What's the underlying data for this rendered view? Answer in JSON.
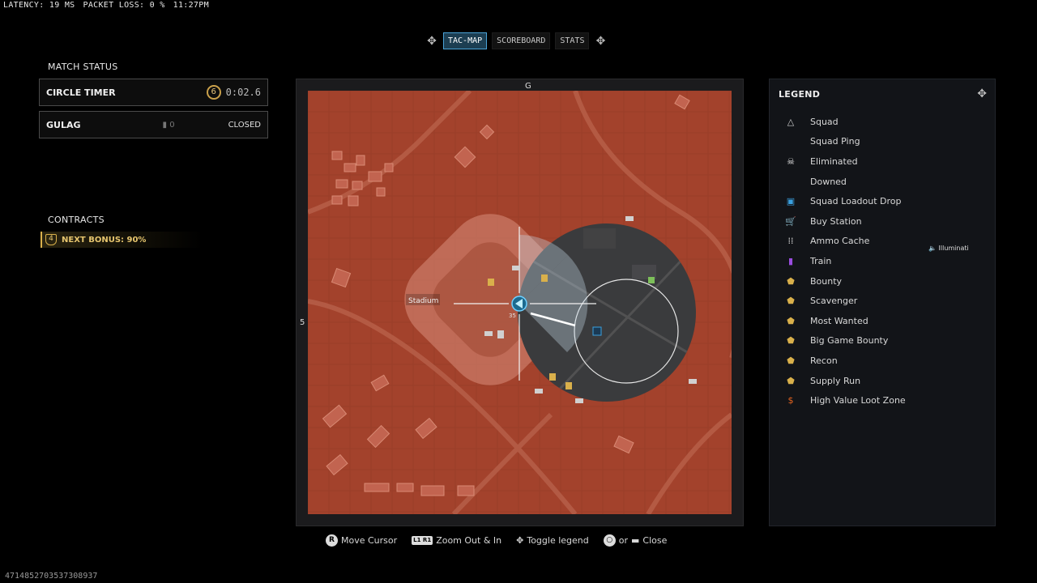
{
  "topbar": {
    "latency": "LATENCY: 19 MS",
    "packet_loss": "PACKET LOSS: 0 %",
    "clock": "11:27PM"
  },
  "tabs": [
    {
      "label": "TAC-MAP",
      "active": true
    },
    {
      "label": "SCOREBOARD",
      "active": false
    },
    {
      "label": "STATS",
      "active": false
    }
  ],
  "match_status": {
    "title": "MATCH STATUS",
    "circle_timer": {
      "label": "CIRCLE TIMER",
      "circle_number": "6",
      "time": "0:02.6"
    },
    "gulag": {
      "label": "GULAG",
      "count": "0",
      "status": "CLOSED"
    }
  },
  "contracts": {
    "title": "CONTRACTS",
    "level": "4",
    "next_bonus": "NEXT BONUS: 90%"
  },
  "map": {
    "compass_top": "G",
    "compass_left": "5",
    "stadium_label": "Stadium",
    "player_marker_number": "35"
  },
  "legend": {
    "title": "LEGEND",
    "items": [
      {
        "label": "Squad",
        "icon": "triangle-icon",
        "color": "#cfcfcf"
      },
      {
        "label": "Squad Ping",
        "icon": "",
        "color": ""
      },
      {
        "label": "Eliminated",
        "icon": "skull-icon",
        "color": "#e0e0e0"
      },
      {
        "label": "Downed",
        "icon": "",
        "color": ""
      },
      {
        "label": "Squad Loadout Drop",
        "icon": "loadout-drop-icon",
        "color": "#3aa0e0"
      },
      {
        "label": "Buy Station",
        "icon": "cart-icon",
        "color": "#7dbf5a"
      },
      {
        "label": "Ammo Cache",
        "icon": "ammo-icon",
        "color": "#d0d0d0"
      },
      {
        "label": "Train",
        "icon": "train-icon",
        "color": "#9a4de0"
      },
      {
        "label": "Bounty",
        "icon": "bounty-icon",
        "color": "#d9b04b"
      },
      {
        "label": "Scavenger",
        "icon": "scavenger-icon",
        "color": "#d9b04b"
      },
      {
        "label": "Most Wanted",
        "icon": "most-wanted-icon",
        "color": "#d9b04b"
      },
      {
        "label": "Big Game Bounty",
        "icon": "big-game-bounty-icon",
        "color": "#d9b04b"
      },
      {
        "label": "Recon",
        "icon": "recon-icon",
        "color": "#d9b04b"
      },
      {
        "label": "Supply Run",
        "icon": "supply-run-icon",
        "color": "#d9b04b"
      },
      {
        "label": "High Value Loot Zone",
        "icon": "dollar-icon",
        "color": "#e8651f"
      }
    ],
    "side_note": "Illuminati"
  },
  "controls": [
    {
      "glyph": "R",
      "label": "Move Cursor"
    },
    {
      "glyph": "L1 R1",
      "label": "Zoom Out & In"
    },
    {
      "glyph": "✥",
      "label": "Toggle legend"
    },
    {
      "glyph": "○",
      "label": "or"
    },
    {
      "glyph": "▬",
      "label": "Close"
    }
  ],
  "session_id": "4714852703537308937",
  "colors": {
    "gas": "#a3422c",
    "safe_zone": "#3a3b3d",
    "accent_blue": "#4aa3d8",
    "gold": "#d9b04b"
  }
}
